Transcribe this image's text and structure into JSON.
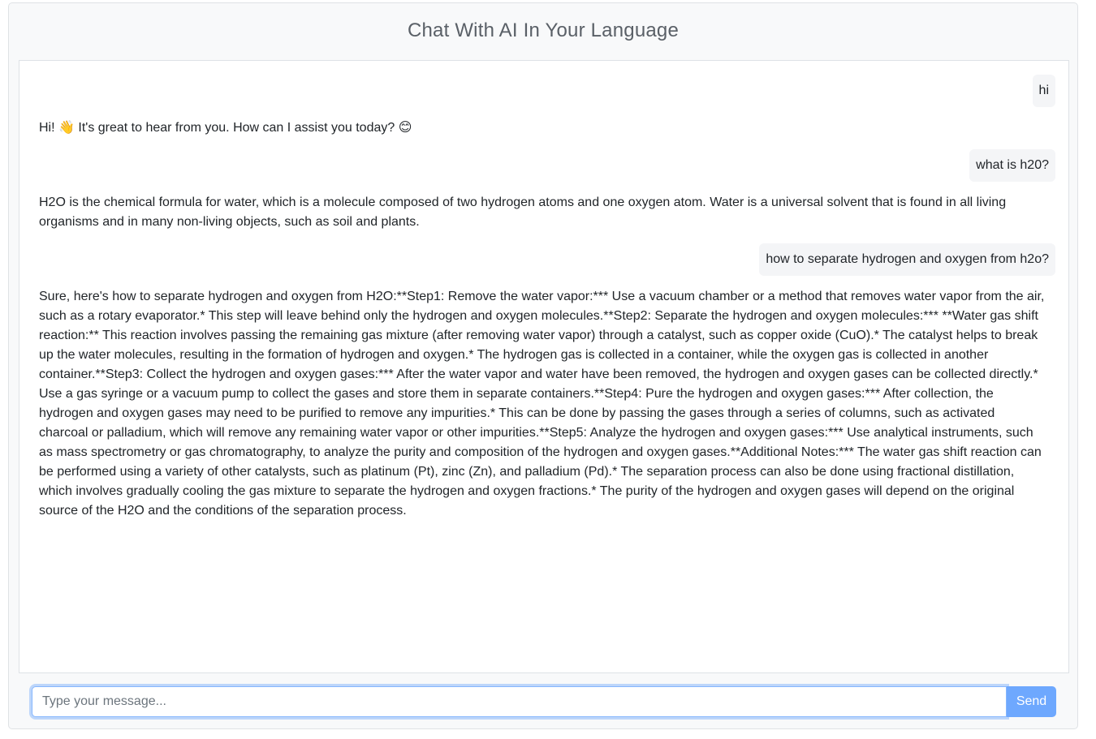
{
  "header": {
    "title": "Chat With AI In Your Language"
  },
  "messages": [
    {
      "role": "user",
      "text": "hi"
    },
    {
      "role": "ai",
      "text": "Hi! 👋 It's great to hear from you. How can I assist you today? 😊"
    },
    {
      "role": "user",
      "text": "what is h20?"
    },
    {
      "role": "ai",
      "text": "H2O is the chemical formula for water, which is a molecule composed of two hydrogen atoms and one oxygen atom. Water is a universal solvent that is found in all living organisms and in many non-living objects, such as soil and plants."
    },
    {
      "role": "user",
      "text": "how to separate hydrogen and oxygen from h2o?"
    },
    {
      "role": "ai",
      "text": "Sure, here's how to separate hydrogen and oxygen from H2O:**Step1: Remove the water vapor:*** Use a vacuum chamber or a method that removes water vapor from the air, such as a rotary evaporator.* This step will leave behind only the hydrogen and oxygen molecules.**Step2: Separate the hydrogen and oxygen molecules:*** **Water gas shift reaction:** This reaction involves passing the remaining gas mixture (after removing water vapor) through a catalyst, such as copper oxide (CuO).* The catalyst helps to break up the water molecules, resulting in the formation of hydrogen and oxygen.* The hydrogen gas is collected in a container, while the oxygen gas is collected in another container.**Step3: Collect the hydrogen and oxygen gases:*** After the water vapor and water have been removed, the hydrogen and oxygen gases can be collected directly.* Use a gas syringe or a vacuum pump to collect the gases and store them in separate containers.**Step4: Pure the hydrogen and oxygen gases:*** After collection, the hydrogen and oxygen gases may need to be purified to remove any impurities.* This can be done by passing the gases through a series of columns, such as activated charcoal or palladium, which will remove any remaining water vapor or other impurities.**Step5: Analyze the hydrogen and oxygen gases:*** Use analytical instruments, such as mass spectrometry or gas chromatography, to analyze the purity and composition of the hydrogen and oxygen gases.**Additional Notes:*** The water gas shift reaction can be performed using a variety of other catalysts, such as platinum (Pt), zinc (Zn), and palladium (Pd).* The separation process can also be done using fractional distillation, which involves gradually cooling the gas mixture to separate the hydrogen and oxygen fractions.* The purity of the hydrogen and oxygen gases will depend on the original source of the H2O and the conditions of the separation process."
    }
  ],
  "composer": {
    "placeholder": "Type your message...",
    "value": "",
    "send_label": "Send"
  },
  "colors": {
    "accent": "#6ea8fe",
    "focus_border": "#86b7fe",
    "user_bubble": "#f4f5f7",
    "panel_bg": "#f8f9fa"
  }
}
